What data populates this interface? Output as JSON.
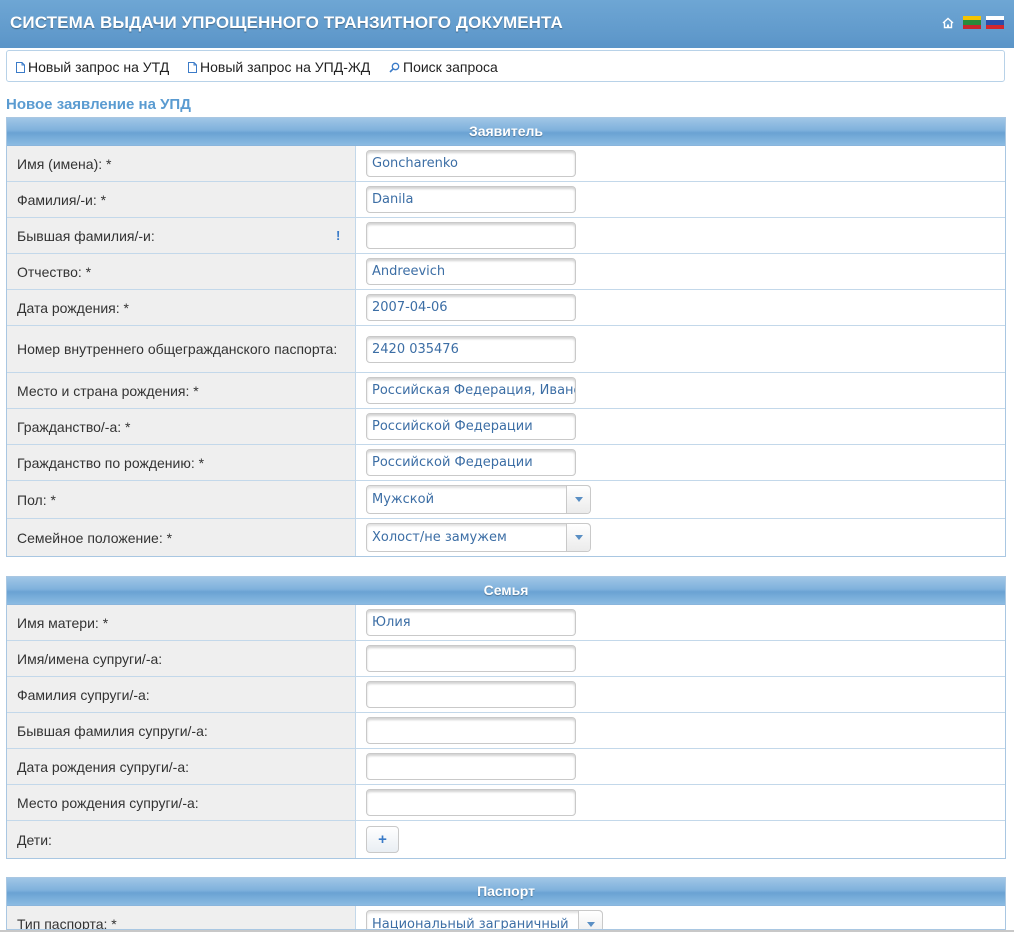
{
  "header": {
    "title": "СИСТЕМА ВЫДАЧИ УПРОЩЕННОГО ТРАНЗИТНОГО ДОКУМЕНТА",
    "icons": [
      "home-icon",
      "lithuania-flag-icon",
      "russia-flag-icon"
    ]
  },
  "nav": {
    "links": [
      {
        "label": "Новый запрос на УТД",
        "icon": "document-icon"
      },
      {
        "label": "Новый запрос на УПД-ЖД",
        "icon": "document-icon"
      },
      {
        "label": "Поиск запроса",
        "icon": "search-icon"
      }
    ]
  },
  "page": {
    "heading": "Новое заявление на УПД"
  },
  "colors": {
    "accent": "#5b95c8",
    "heading": "#5a9bd1",
    "value_text": "#3c6ea5",
    "label_bg": "#efefef"
  },
  "applicant": {
    "title": "Заявитель",
    "rows": [
      {
        "label": "Имя (имена): *",
        "value": "Goncharenko",
        "type": "text"
      },
      {
        "label": "Фамилия/-и: *",
        "value": "Danila",
        "type": "text"
      },
      {
        "label": "Бывшая фамилия/-и:",
        "value": "",
        "type": "text",
        "note": "!"
      },
      {
        "label": "Отчество: *",
        "value": "Andreevich",
        "type": "text"
      },
      {
        "label": "Дата рождения: *",
        "value": "2007-04-06",
        "type": "text"
      },
      {
        "label": "Номер внутреннего общегражданского паспорта:",
        "value": "2420 035476",
        "type": "text"
      },
      {
        "label": "Место и страна рождения: *",
        "value": "Российская Федерация, Ивано",
        "type": "text"
      },
      {
        "label": "Гражданство/-а: *",
        "value": "Российской Федерации",
        "type": "text"
      },
      {
        "label": "Гражданство по рождению: *",
        "value": "Российской Федерации",
        "type": "text"
      },
      {
        "label": "Пол: *",
        "value": "Мужской",
        "type": "select"
      },
      {
        "label": "Семейное положение: *",
        "value": "Холост/не замужем",
        "type": "select"
      }
    ]
  },
  "family": {
    "title": "Семья",
    "rows": [
      {
        "label": "Имя матери: *",
        "value": "Юлия",
        "type": "text"
      },
      {
        "label": "Имя/имена супруги/-а:",
        "value": "",
        "type": "text"
      },
      {
        "label": "Фамилия супруги/-а:",
        "value": "",
        "type": "text"
      },
      {
        "label": "Бывшая фамилия супруги/-а:",
        "value": "",
        "type": "text"
      },
      {
        "label": "Дата рождения супруги/-а:",
        "value": "",
        "type": "text"
      },
      {
        "label": "Место рождения супруги/-а:",
        "value": "",
        "type": "text"
      },
      {
        "label": "Дети:",
        "value": "+",
        "type": "add"
      }
    ]
  },
  "passport": {
    "title": "Паспорт",
    "rows": [
      {
        "label": "Тип паспорта: *",
        "value": "Национальный заграничный",
        "type": "select"
      }
    ]
  }
}
